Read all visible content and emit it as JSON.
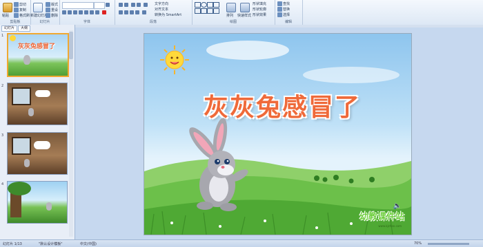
{
  "ribbon": {
    "groups": [
      {
        "name": "clipboard",
        "label": "剪贴板"
      },
      {
        "name": "slides",
        "label": "幻灯片"
      },
      {
        "name": "font",
        "label": "字体"
      },
      {
        "name": "paragraph",
        "label": "段落"
      },
      {
        "name": "drawing",
        "label": "绘图"
      },
      {
        "name": "editing",
        "label": "编辑"
      }
    ],
    "paste_label": "粘贴",
    "cut_label": "剪切",
    "copy_label": "复制",
    "format_painter_label": "格式刷",
    "new_slide_label": "新建幻灯片",
    "layout_label": "版式",
    "reset_label": "重设",
    "delete_label": "删除",
    "text_direction_label": "文字方向",
    "align_text_label": "对齐文本",
    "smartart_label": "转换为 SmartArt",
    "arrange_label": "排列",
    "quick_styles_label": "快速样式",
    "shape_fill_label": "形状填充",
    "shape_outline_label": "形状轮廓",
    "shape_effects_label": "形状效果",
    "find_label": "查找",
    "replace_label": "替换",
    "select_label": "选择"
  },
  "left_panel": {
    "tab_slides": "幻灯片",
    "tab_outline": "大纲",
    "thumbnails": [
      {
        "num": "1",
        "caption": "灰灰兔感冒了"
      },
      {
        "num": "2",
        "caption": ""
      },
      {
        "num": "3",
        "caption": ""
      },
      {
        "num": "4",
        "caption": ""
      }
    ]
  },
  "slide": {
    "title": "灰灰兔感冒了",
    "logo_text": "幼教课件站",
    "logo_sub": "www.kjzhan.com"
  },
  "status": {
    "slide_count": "幻灯片 1/13",
    "theme": "\"默认设计模板\"",
    "language": "中文(中国)",
    "zoom": "70%"
  },
  "colors": {
    "title": "#ef6a3a",
    "sky": "#8ec5ee",
    "grass": "#6cc04a",
    "selected_thumb_border": "#f0a830"
  }
}
